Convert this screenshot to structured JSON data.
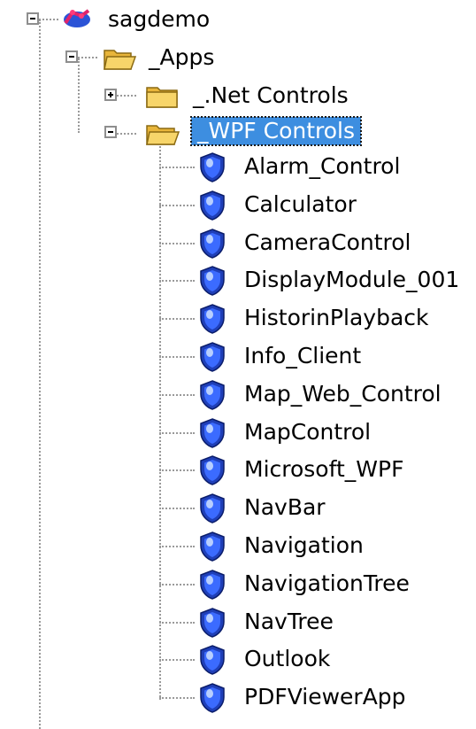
{
  "root": {
    "label": "sagdemo",
    "icon": "network-root-icon"
  },
  "apps": {
    "label": "_Apps",
    "icon": "folder-open-icon"
  },
  "children": [
    {
      "label": "_.Net Controls",
      "icon": "folder-closed-icon",
      "expanded": false
    },
    {
      "label": "_WPF Controls",
      "icon": "folder-open-icon",
      "expanded": true,
      "selected": true
    }
  ],
  "wpf_items": [
    {
      "label": "Alarm_Control",
      "icon": "shield-app-icon"
    },
    {
      "label": "Calculator",
      "icon": "shield-app-icon"
    },
    {
      "label": "CameraControl",
      "icon": "shield-app-icon"
    },
    {
      "label": "DisplayModule_001",
      "icon": "shield-app-icon"
    },
    {
      "label": "HistorinPlayback",
      "icon": "shield-app-icon"
    },
    {
      "label": "Info_Client",
      "icon": "shield-app-icon"
    },
    {
      "label": "Map_Web_Control",
      "icon": "shield-app-icon"
    },
    {
      "label": "MapControl",
      "icon": "shield-app-icon"
    },
    {
      "label": "Microsoft_WPF",
      "icon": "shield-app-icon"
    },
    {
      "label": "NavBar",
      "icon": "shield-app-icon"
    },
    {
      "label": "Navigation",
      "icon": "shield-app-icon"
    },
    {
      "label": "NavigationTree",
      "icon": "shield-app-icon"
    },
    {
      "label": "NavTree",
      "icon": "shield-app-icon"
    },
    {
      "label": "Outlook",
      "icon": "shield-app-icon"
    },
    {
      "label": "PDFViewerApp",
      "icon": "shield-app-icon"
    }
  ],
  "colors": {
    "selection": "#3d8ee0",
    "connector": "#9a9a9a",
    "folder": "#f2c94c",
    "shield": "#2a52d6"
  }
}
